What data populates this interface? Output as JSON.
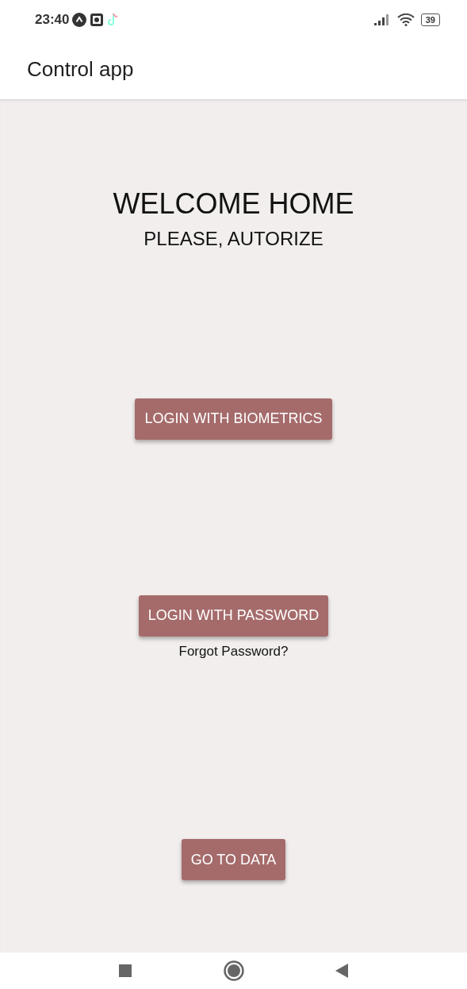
{
  "status_bar": {
    "time": "23:40",
    "battery": "39"
  },
  "app_bar": {
    "title": "Control app"
  },
  "heading": {
    "title": "WELCOME HOME",
    "subtitle": "PLEASE, AUTORIZE"
  },
  "actions": [
    {
      "kind": "button",
      "label": "LOGIN WITH BIOMETRICS"
    },
    {
      "kind": "button",
      "label": "LOGIN WITH PASSWORD"
    },
    {
      "kind": "link",
      "label": "Forgot Password?"
    },
    {
      "kind": "button",
      "label": "GO TO DATA"
    }
  ]
}
